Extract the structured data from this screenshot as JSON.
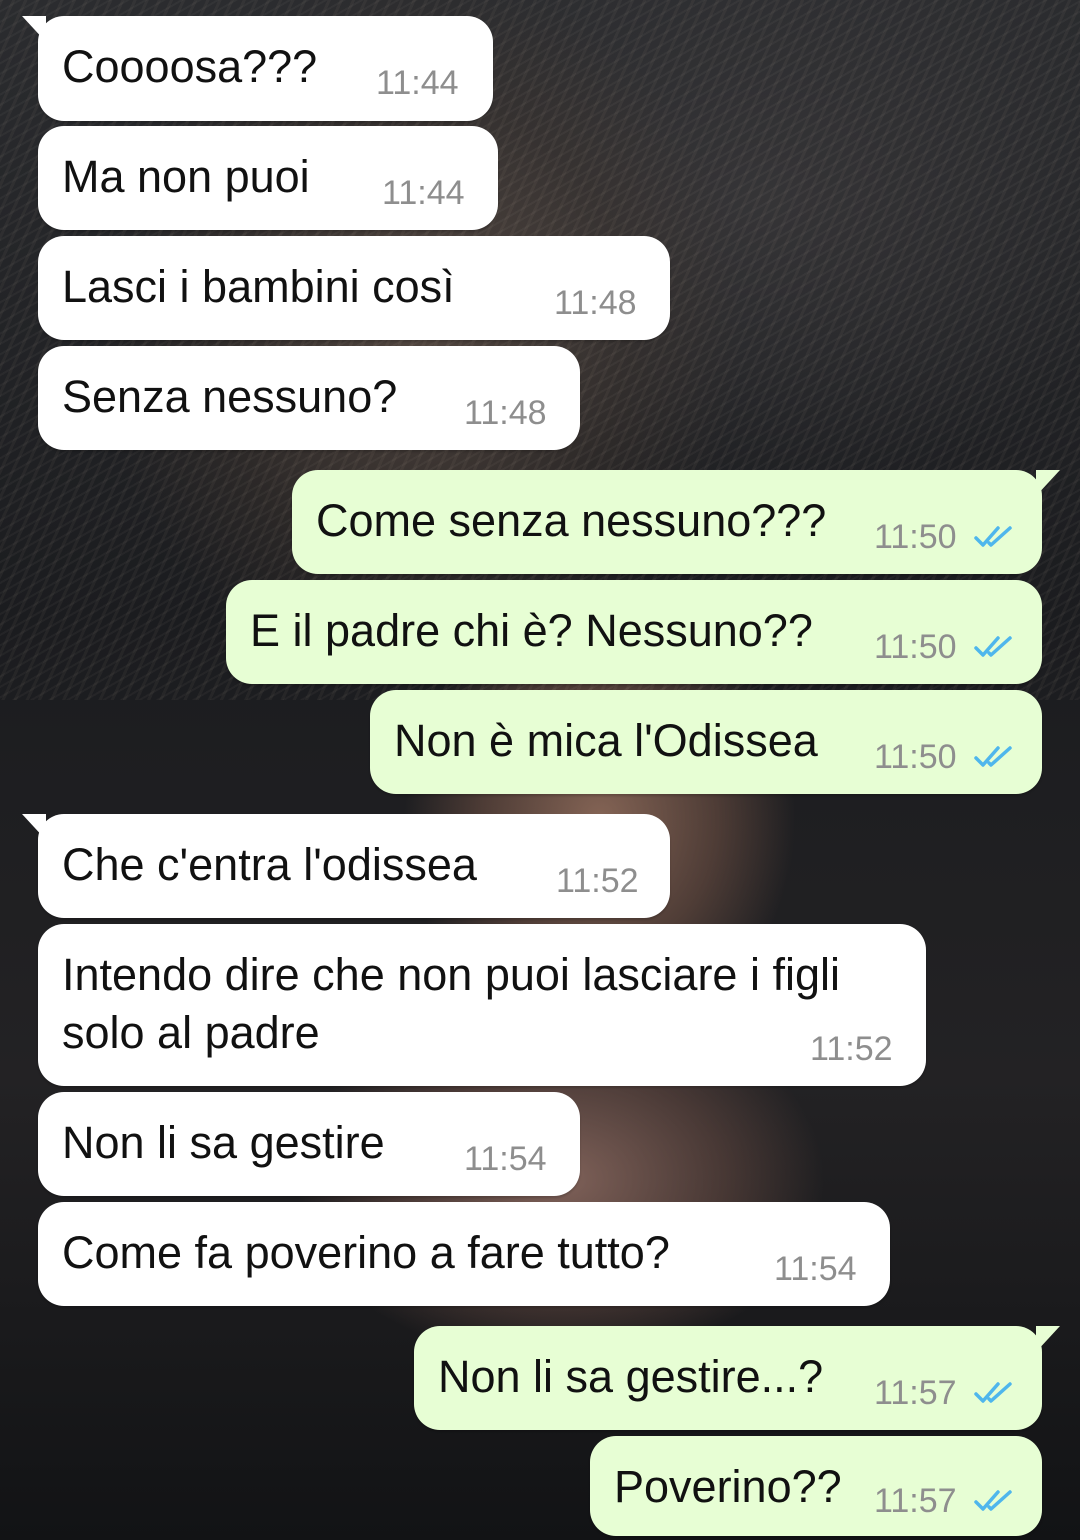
{
  "chat": {
    "messages": [
      {
        "direction": "incoming",
        "text": "Coooosa???",
        "time": "11:44"
      },
      {
        "direction": "incoming",
        "text": "Ma non puoi",
        "time": "11:44"
      },
      {
        "direction": "incoming",
        "text": "Lasci i bambini così",
        "time": "11:48"
      },
      {
        "direction": "incoming",
        "text": "Senza nessuno?",
        "time": "11:48"
      },
      {
        "direction": "outgoing",
        "text": "Come senza nessuno???",
        "time": "11:50",
        "status": "read"
      },
      {
        "direction": "outgoing",
        "text": "E il padre chi è? Nessuno??",
        "time": "11:50",
        "status": "read"
      },
      {
        "direction": "outgoing",
        "text": "Non è mica l'Odissea",
        "time": "11:50",
        "status": "read"
      },
      {
        "direction": "incoming",
        "text": "Che c'entra l'odissea",
        "time": "11:52"
      },
      {
        "direction": "incoming",
        "text": "Intendo dire che non puoi lasciare i figli solo al padre",
        "time": "11:52"
      },
      {
        "direction": "incoming",
        "text": "Non li sa gestire",
        "time": "11:54"
      },
      {
        "direction": "incoming",
        "text": "Come fa poverino a fare tutto?",
        "time": "11:54"
      },
      {
        "direction": "outgoing",
        "text": "Non li sa gestire...?",
        "time": "11:57",
        "status": "read"
      },
      {
        "direction": "outgoing",
        "text": "Poverino??",
        "time": "11:57",
        "status": "read"
      }
    ]
  },
  "colors": {
    "incoming_bubble": "#ffffff",
    "outgoing_bubble": "#e7fed4",
    "read_ticks": "#4fb6ec",
    "timestamp": "#8e8e8e"
  },
  "icons": {
    "read_status": "double-check-icon"
  }
}
